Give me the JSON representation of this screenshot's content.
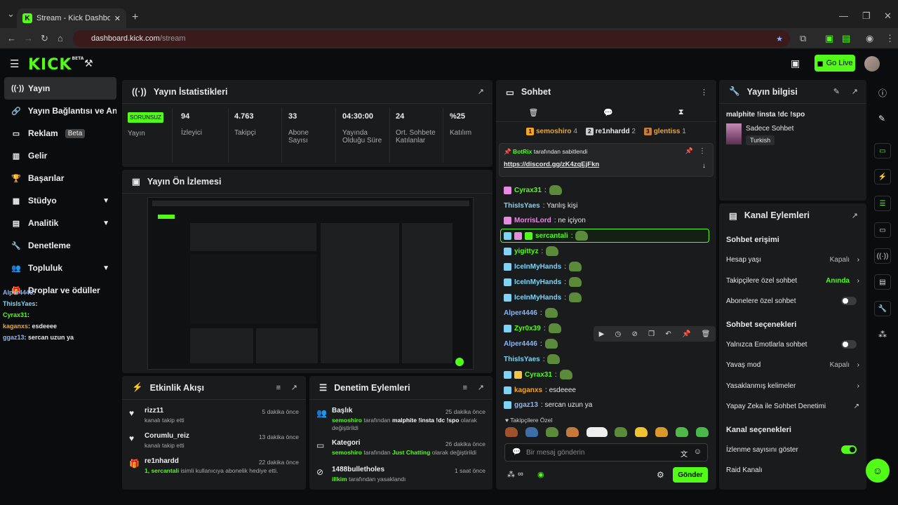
{
  "browser": {
    "tab_title": "Stream - Kick Dashboard",
    "url_host": "dashboard.kick.com",
    "url_path": "/stream"
  },
  "topbar": {
    "logo": "KICK",
    "logo_sup": "BETA",
    "go_live": "Go Live"
  },
  "sidebar": {
    "items": [
      {
        "label": "Yayın"
      },
      {
        "label": "Yayın Bağlantısı ve Anahtarı"
      },
      {
        "label": "Reklam",
        "badge": "Beta"
      },
      {
        "label": "Gelir"
      },
      {
        "label": "Başarılar"
      },
      {
        "label": "Stüdyo"
      },
      {
        "label": "Analitik"
      },
      {
        "label": "Denetleme"
      },
      {
        "label": "Topluluk"
      },
      {
        "label": "Droplar ve ödüller"
      }
    ],
    "overlay": [
      {
        "user": "Alper4446",
        "text": ":"
      },
      {
        "user": "ThisIsYaes",
        "text": ":"
      },
      {
        "user": "Cyrax31",
        "text": ":"
      },
      {
        "user": "kaganxs",
        "text": ": esdeeee"
      },
      {
        "user": "ggaz13",
        "text": ": sercan uzun ya"
      }
    ]
  },
  "stats": {
    "title": "Yayın İstatistikleri",
    "status": "SORUNSUZ",
    "status_label": "Yayın",
    "items": [
      {
        "value": "94",
        "label": "İzleyici"
      },
      {
        "value": "4.763",
        "label": "Takipçi"
      },
      {
        "value": "33",
        "label": "Abone Sayısı"
      },
      {
        "value": "04:30:00",
        "label": "Yayında Olduğu Süre"
      },
      {
        "value": "24",
        "label": "Ort. Sohbete Katılanlar"
      },
      {
        "value": "%25",
        "label": "Katılım"
      }
    ]
  },
  "preview": {
    "title": "Yayın Ön İzlemesi"
  },
  "activity": {
    "title": "Etkinlik Akışı",
    "rows": [
      {
        "name": "rizz11",
        "sub": "kanalı takip etti",
        "time": "5 dakika önce"
      },
      {
        "name": "Corumlu_reiz",
        "sub": "kanalı takip etti",
        "time": "13 dakika önce"
      },
      {
        "name": "re1nhardd",
        "sub_hl": "1, sercantali",
        "sub": " isimli kullanıcıya abonelik hediye etti.",
        "time": "22 dakika önce"
      }
    ]
  },
  "moderation": {
    "title": "Denetim Eylemleri",
    "rows": [
      {
        "name": "Başlık",
        "actor": "semoshiro",
        "mid": " tarafından ",
        "target": "malphite !insta !dc !spo",
        "end": " olarak değiştirildi",
        "time": "25 dakika önce"
      },
      {
        "name": "Kategori",
        "actor": "semoshiro",
        "mid": " tarafından ",
        "target": "Just Chatting",
        "end": " olarak değiştirildi",
        "time": "26 dakika önce"
      },
      {
        "name": "1488bulletholes",
        "actor": "illkim",
        "mid": " tarafından yasaklandı",
        "target": "",
        "end": "",
        "time": "1 saat önce"
      }
    ]
  },
  "chat": {
    "title": "Sohbet",
    "top": [
      {
        "rank": "1",
        "name": "semoshiro",
        "count": "4"
      },
      {
        "rank": "2",
        "name": "re1nhardd",
        "count": "2"
      },
      {
        "rank": "3",
        "name": "glentiss",
        "count": "1"
      }
    ],
    "pinned_by": "BotRix",
    "pinned_suffix": "tarafından sabitlendi",
    "pinned_link": "https://discord.gg/zK4zqEjFkn",
    "messages": [
      {
        "user": "Cyrax31",
        "text": ":",
        "color": "#53fc18"
      },
      {
        "user": "ThisIsYaes",
        "text": ": Yanlış kişi",
        "color": "#7fd4f5"
      },
      {
        "user": "MorrisLord",
        "text": ": ne içiyon",
        "color": "#e58ce0"
      },
      {
        "user": "sercantali",
        "text": ":",
        "color": "#53fc18"
      },
      {
        "user": "yigittyz",
        "text": ":",
        "color": "#53fc18"
      },
      {
        "user": "IceInMyHands",
        "text": ":",
        "color": "#7fd4f5"
      },
      {
        "user": "IceInMyHands",
        "text": ":",
        "color": "#7fd4f5"
      },
      {
        "user": "IceInMyHands",
        "text": ":",
        "color": "#7fd4f5"
      },
      {
        "user": "Alper4446",
        "text": ":",
        "color": "#8fb5f0"
      },
      {
        "user": "Zyr0x39",
        "text": ":",
        "color": "#53fc18"
      },
      {
        "user": "Alper4446",
        "text": ":",
        "color": "#8fb5f0"
      },
      {
        "user": "ThisIsYaes",
        "text": ":",
        "color": "#7fd4f5"
      },
      {
        "user": "Cyrax31",
        "text": ":",
        "color": "#53fc18"
      },
      {
        "user": "kaganxs",
        "text": ": esdeeee",
        "color": "#f5a623"
      },
      {
        "user": "ggaz13",
        "text": ": sercan uzun ya",
        "color": "#8fb5f0"
      }
    ],
    "emote_label": "Takipçilere Özel",
    "placeholder": "Bir mesaj gönderin",
    "send": "Gönder"
  },
  "stream_info": {
    "title": "Yayın bilgisi",
    "stream_title": "malphite !insta !dc !spo",
    "category": "Sadece Sohbet",
    "language": "Turkish"
  },
  "channel_actions": {
    "title": "Kanal Eylemleri",
    "sec1": "Sohbet erişimi",
    "account_age": "Hesap yaşı",
    "account_age_val": "Kapalı",
    "followers_only": "Takipçilere özel sohbet",
    "followers_only_val": "Anında",
    "subs_only": "Abonelere özel sohbet",
    "sec2": "Sohbet seçenekleri",
    "emote_only": "Yalnızca Emotlarla sohbet",
    "slow_mode": "Yavaş mod",
    "slow_mode_val": "Kapalı",
    "banned_words": "Yasaklanmış kelimeler",
    "ai_mod": "Yapay Zeka ile Sohbet Denetimi",
    "sec3": "Kanal seçenekleri",
    "show_viewers": "İzlenme sayısını göster",
    "raid": "Raid Kanalı"
  },
  "colors": {
    "accent": "#53fc18",
    "panel": "#191b1c",
    "bg": "#0b0c0d"
  }
}
